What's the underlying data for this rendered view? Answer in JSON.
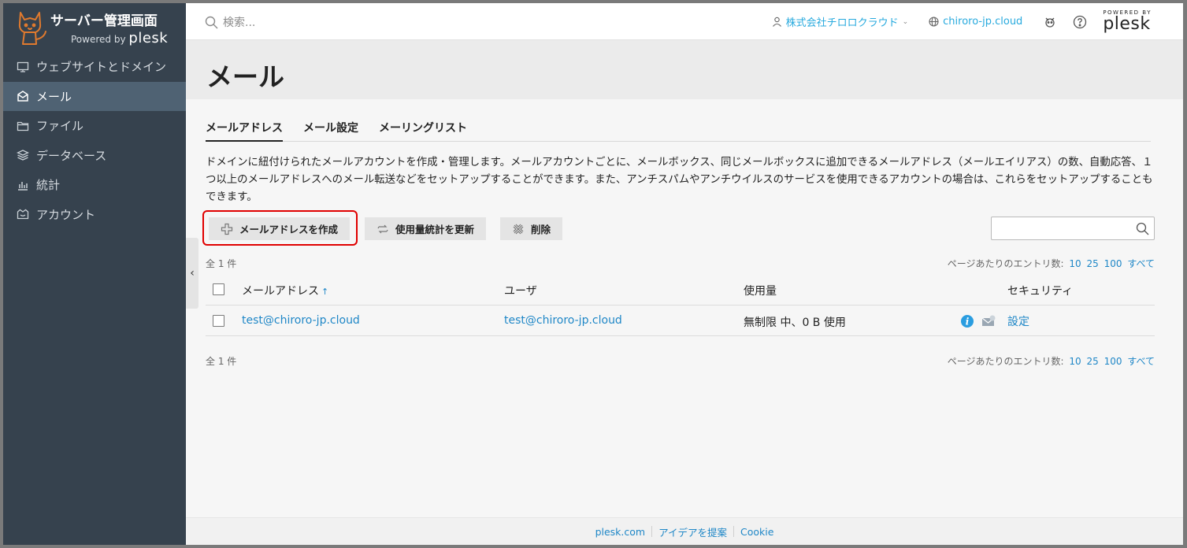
{
  "brand": {
    "title": "サーバー管理画面",
    "powered_by": "Powered by",
    "plesk": "plesk"
  },
  "sidebar": {
    "items": [
      {
        "label": "ウェブサイトとドメイン",
        "icon": "monitor-icon",
        "active": false
      },
      {
        "label": "メール",
        "icon": "mail-icon",
        "active": true
      },
      {
        "label": "ファイル",
        "icon": "folder-icon",
        "active": false
      },
      {
        "label": "データベース",
        "icon": "database-icon",
        "active": false
      },
      {
        "label": "統計",
        "icon": "chart-icon",
        "active": false
      },
      {
        "label": "アカウント",
        "icon": "account-icon",
        "active": false
      }
    ]
  },
  "topbar": {
    "search_placeholder": "検索...",
    "user": "株式会社チロロクラウド",
    "domain": "chiroro-jp.cloud",
    "logo_powered": "POWERED BY",
    "logo_name": "plesk"
  },
  "page": {
    "title": "メール"
  },
  "tabs": [
    {
      "label": "メールアドレス",
      "active": true
    },
    {
      "label": "メール設定",
      "active": false
    },
    {
      "label": "メーリングリスト",
      "active": false
    }
  ],
  "description": "ドメインに紐付けられたメールアカウントを作成・管理します。メールアカウントごとに、メールボックス、同じメールボックスに追加できるメールアドレス（メールエイリアス）の数、自動応答、１つ以上のメールアドレスへのメール転送などをセットアップすることができます。また、アンチスパムやアンチウイルスのサービスを使用できるアカウントの場合は、これらをセットアップすることもできます。",
  "toolbar": {
    "create_label": "メールアドレスを作成",
    "refresh_label": "使用量統計を更新",
    "delete_label": "削除"
  },
  "list": {
    "count_text": "全 1 件",
    "perpage_label": "ページあたりのエントリ数:",
    "perpage_options": [
      "10",
      "25",
      "100",
      "すべて"
    ],
    "columns": {
      "email": "メールアドレス",
      "user": "ユーザ",
      "usage": "使用量",
      "security": "セキュリティ"
    },
    "sort_indicator": "↑",
    "rows": [
      {
        "email": "test@chiroro-jp.cloud",
        "user": "test@chiroro-jp.cloud",
        "usage": "無制限 中、0 B 使用",
        "security_link": "設定"
      }
    ]
  },
  "footer": {
    "links": [
      "plesk.com",
      "アイデアを提案",
      "Cookie"
    ]
  },
  "colors": {
    "sidebar_bg": "#36424e",
    "sidebar_active": "#4f6273",
    "link": "#1f87c7",
    "highlight": "#e00000"
  }
}
